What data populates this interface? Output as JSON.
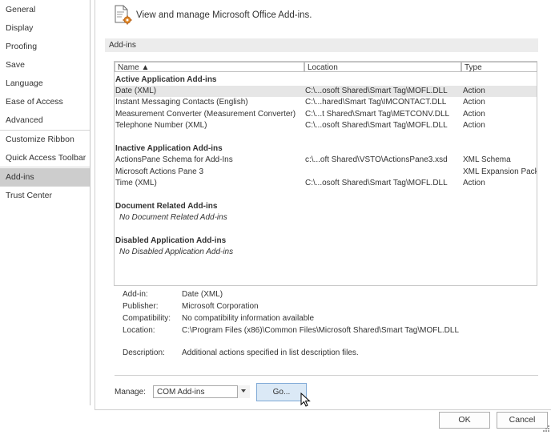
{
  "nav": {
    "items": [
      {
        "label": "General"
      },
      {
        "label": "Display"
      },
      {
        "label": "Proofing"
      },
      {
        "label": "Save"
      },
      {
        "label": "Language"
      },
      {
        "label": "Ease of Access"
      },
      {
        "label": "Advanced"
      },
      {
        "label": "Customize Ribbon"
      },
      {
        "label": "Quick Access Toolbar"
      },
      {
        "label": "Add-ins"
      },
      {
        "label": "Trust Center"
      }
    ],
    "selected": "Add-ins"
  },
  "header": {
    "text": "View and manage Microsoft Office Add-ins.",
    "icon": "addins-gear-icon"
  },
  "section": {
    "label": "Add-ins"
  },
  "list": {
    "columns": {
      "name": "Name ▲",
      "location": "Location",
      "type": "Type"
    },
    "groups": {
      "active": {
        "label": "Active Application Add-ins",
        "rows": [
          {
            "name": "Date (XML)",
            "location": "C:\\...osoft Shared\\Smart Tag\\MOFL.DLL",
            "type": "Action"
          },
          {
            "name": "Instant Messaging Contacts (English)",
            "location": "C:\\...hared\\Smart Tag\\IMCONTACT.DLL",
            "type": "Action"
          },
          {
            "name": "Measurement Converter (Measurement Converter)",
            "location": "C:\\...t Shared\\Smart Tag\\METCONV.DLL",
            "type": "Action"
          },
          {
            "name": "Telephone Number (XML)",
            "location": "C:\\...osoft Shared\\Smart Tag\\MOFL.DLL",
            "type": "Action"
          }
        ]
      },
      "inactive": {
        "label": "Inactive Application Add-ins",
        "rows": [
          {
            "name": "ActionsPane Schema for Add-Ins",
            "location": "c:\\...oft Shared\\VSTO\\ActionsPane3.xsd",
            "type": "XML Schema"
          },
          {
            "name": "Microsoft Actions Pane 3",
            "location": "",
            "type": "XML Expansion Pack"
          },
          {
            "name": "Time (XML)",
            "location": "C:\\...osoft Shared\\Smart Tag\\MOFL.DLL",
            "type": "Action"
          }
        ]
      },
      "document": {
        "label": "Document Related Add-ins",
        "empty": "No Document Related Add-ins"
      },
      "disabled": {
        "label": "Disabled Application Add-ins",
        "empty": "No Disabled Application Add-ins"
      }
    }
  },
  "details": {
    "addin_label": "Add-in:",
    "addin": "Date (XML)",
    "publisher_label": "Publisher:",
    "publisher": "Microsoft Corporation",
    "compat_label": "Compatibility:",
    "compat": "No compatibility information available",
    "location_label": "Location:",
    "location": "C:\\Program Files (x86)\\Common Files\\Microsoft Shared\\Smart Tag\\MOFL.DLL",
    "desc_label": "Description:",
    "desc": "Additional actions specified in list description files."
  },
  "manage": {
    "label": "Manage:",
    "value": "COM Add-ins",
    "go": "Go..."
  },
  "buttons": {
    "ok": "OK",
    "cancel": "Cancel"
  }
}
